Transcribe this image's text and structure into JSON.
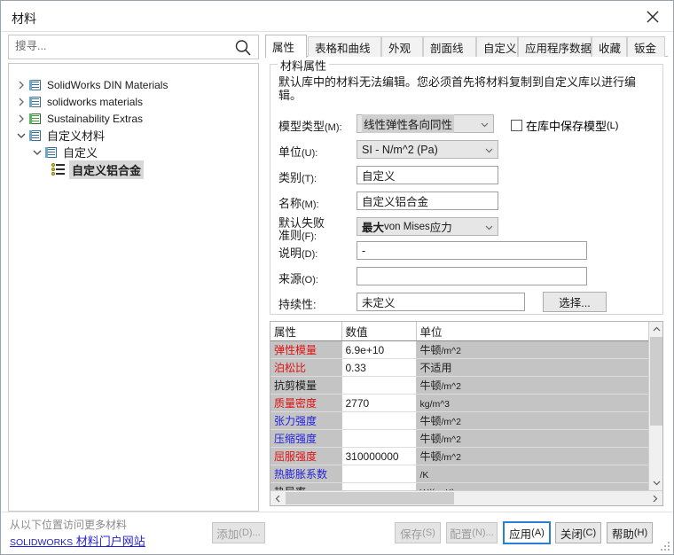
{
  "window": {
    "title": "材料",
    "close_icon": "close-icon"
  },
  "search": {
    "placeholder": "搜寻...",
    "value": "",
    "icon": "search-icon"
  },
  "tree": {
    "items": [
      {
        "label": "SolidWorks DIN Materials",
        "indent": 0,
        "expanded": false,
        "icon": "folder-blue-icon",
        "selected": false
      },
      {
        "label": "solidworks materials",
        "indent": 0,
        "expanded": false,
        "icon": "folder-blue-icon",
        "selected": false
      },
      {
        "label": "Sustainability Extras",
        "indent": 0,
        "expanded": false,
        "icon": "folder-green-icon",
        "selected": false
      },
      {
        "label": "自定义材料",
        "indent": 0,
        "expanded": true,
        "icon": "folder-blue-icon",
        "selected": false
      },
      {
        "label": "自定义",
        "indent": 1,
        "expanded": true,
        "icon": "folder-blue-icon",
        "selected": false
      },
      {
        "label": "自定义铝合金",
        "indent": 2,
        "expanded": null,
        "icon": "material-icon",
        "selected": true
      }
    ]
  },
  "tabs": [
    {
      "label": "属性",
      "active": true
    },
    {
      "label": "表格和曲线",
      "active": false
    },
    {
      "label": "外观",
      "active": false
    },
    {
      "label": "剖面线",
      "active": false
    },
    {
      "label": "自定义",
      "active": false
    },
    {
      "label": "应用程序数据",
      "active": false
    },
    {
      "label": "收藏",
      "active": false
    },
    {
      "label": "钣金",
      "active": false
    }
  ],
  "properties_group": {
    "title": "材料属性",
    "description": "默认库中的材料无法编辑。您必须首先将材料复制到自定义库以进行编辑。",
    "fields": {
      "model_type": {
        "label": "模型类型",
        "mnemonic": "(M):",
        "value": "线性弹性各向同性",
        "type": "combo"
      },
      "units": {
        "label": "单位",
        "mnemonic": "(U):",
        "value": "SI - N/m^2 (Pa)",
        "type": "combo"
      },
      "category": {
        "label": "类别",
        "mnemonic": "(T):",
        "value": "自定义",
        "type": "text"
      },
      "name": {
        "label": "名称",
        "mnemonic": "(M):",
        "value": "自定义铝合金",
        "type": "text"
      },
      "failure_criterion": {
        "label_line1": "默认失败",
        "label_line2": "准则",
        "mnemonic": "(F):",
        "value_bold": "最大",
        "value_mid": " von Mises ",
        "value_end": "应力",
        "type": "combo"
      },
      "description": {
        "label": "说明",
        "mnemonic": "(D):",
        "value": "-",
        "type": "text"
      },
      "source": {
        "label": "来源",
        "mnemonic": "(O):",
        "value": "",
        "type": "text"
      },
      "sustainability": {
        "label": "持续性:",
        "value": "未定义",
        "type": "text",
        "button": "选择..."
      }
    },
    "save_model_checkbox": {
      "label": "在库中保存模型",
      "mnemonic": "(L)",
      "checked": false
    }
  },
  "property_table": {
    "headers": [
      "属性",
      "数值",
      "单位"
    ],
    "rows": [
      {
        "name": "弹性模量",
        "value": "6.9e+10",
        "unit": "牛顿",
        "unit_suffix": "/m^2",
        "color": "req"
      },
      {
        "name": "泊松比",
        "value": "0.33",
        "unit": "不适用",
        "unit_suffix": "",
        "color": "req"
      },
      {
        "name": "抗剪模量",
        "value": "",
        "unit": "牛顿",
        "unit_suffix": "/m^2",
        "color": "norm"
      },
      {
        "name": "质量密度",
        "value": "2770",
        "unit": "",
        "unit_suffix": "kg/m^3",
        "color": "req"
      },
      {
        "name": "张力强度",
        "value": "",
        "unit": "牛顿",
        "unit_suffix": "/m^2",
        "color": "opt"
      },
      {
        "name": "压缩强度",
        "value": "",
        "unit": "牛顿",
        "unit_suffix": "/m^2",
        "color": "opt"
      },
      {
        "name": "屈服强度",
        "value": "310000000",
        "unit": "牛顿",
        "unit_suffix": "/m^2",
        "color": "req"
      },
      {
        "name": "热膨胀系数",
        "value": "",
        "unit": "",
        "unit_suffix": "/K",
        "color": "opt"
      },
      {
        "name": "热导率",
        "value": "",
        "unit": "",
        "unit_suffix": "W/(m·K)",
        "color": "norm"
      }
    ]
  },
  "footer": {
    "note": "从以下位置访问更多材料",
    "link_prefix": "SOLIDWORKS",
    "link_text": " 材料门户网站",
    "buttons": {
      "add": {
        "label": "添加",
        "mnemonic": "(D)...",
        "disabled": true
      },
      "save": {
        "label": "保存",
        "mnemonic": "(S)",
        "disabled": true
      },
      "config": {
        "label": "配置",
        "mnemonic": "(N)...",
        "disabled": true
      },
      "apply": {
        "label": "应用",
        "mnemonic": "(A)",
        "disabled": false,
        "focused": true
      },
      "close": {
        "label": "关闭",
        "mnemonic": "(C)",
        "disabled": false
      },
      "help": {
        "label": "帮助",
        "mnemonic": "(H)",
        "disabled": false
      }
    }
  }
}
